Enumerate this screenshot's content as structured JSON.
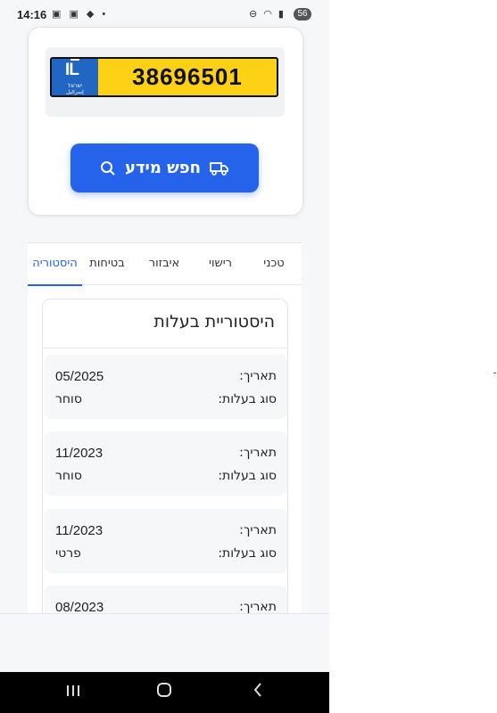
{
  "status_bar": {
    "time": "14:16",
    "battery": "56"
  },
  "plate": {
    "number": "38696501",
    "country_code": "IL",
    "country_heb": "ישראל",
    "country_arabic": "إسرائيل"
  },
  "search_button": {
    "label": "חפש מידע",
    "color": "#2563eb"
  },
  "tabs": [
    {
      "label": "טכני",
      "active": false
    },
    {
      "label": "רישוי",
      "active": false
    },
    {
      "label": "איבזור",
      "active": false
    },
    {
      "label": "בטיחות",
      "active": false
    },
    {
      "label": "היסטוריה",
      "active": true
    }
  ],
  "history": {
    "title": "היסטוריית בעלות",
    "date_label": "תאריך:",
    "owner_label": "סוג בעלות:",
    "entries": [
      {
        "date": "05/2025",
        "type": "סוחר"
      },
      {
        "date": "11/2023",
        "type": "סוחר"
      },
      {
        "date": "11/2023",
        "type": "פרטי"
      },
      {
        "date": "08/2023",
        "type": ""
      }
    ]
  }
}
